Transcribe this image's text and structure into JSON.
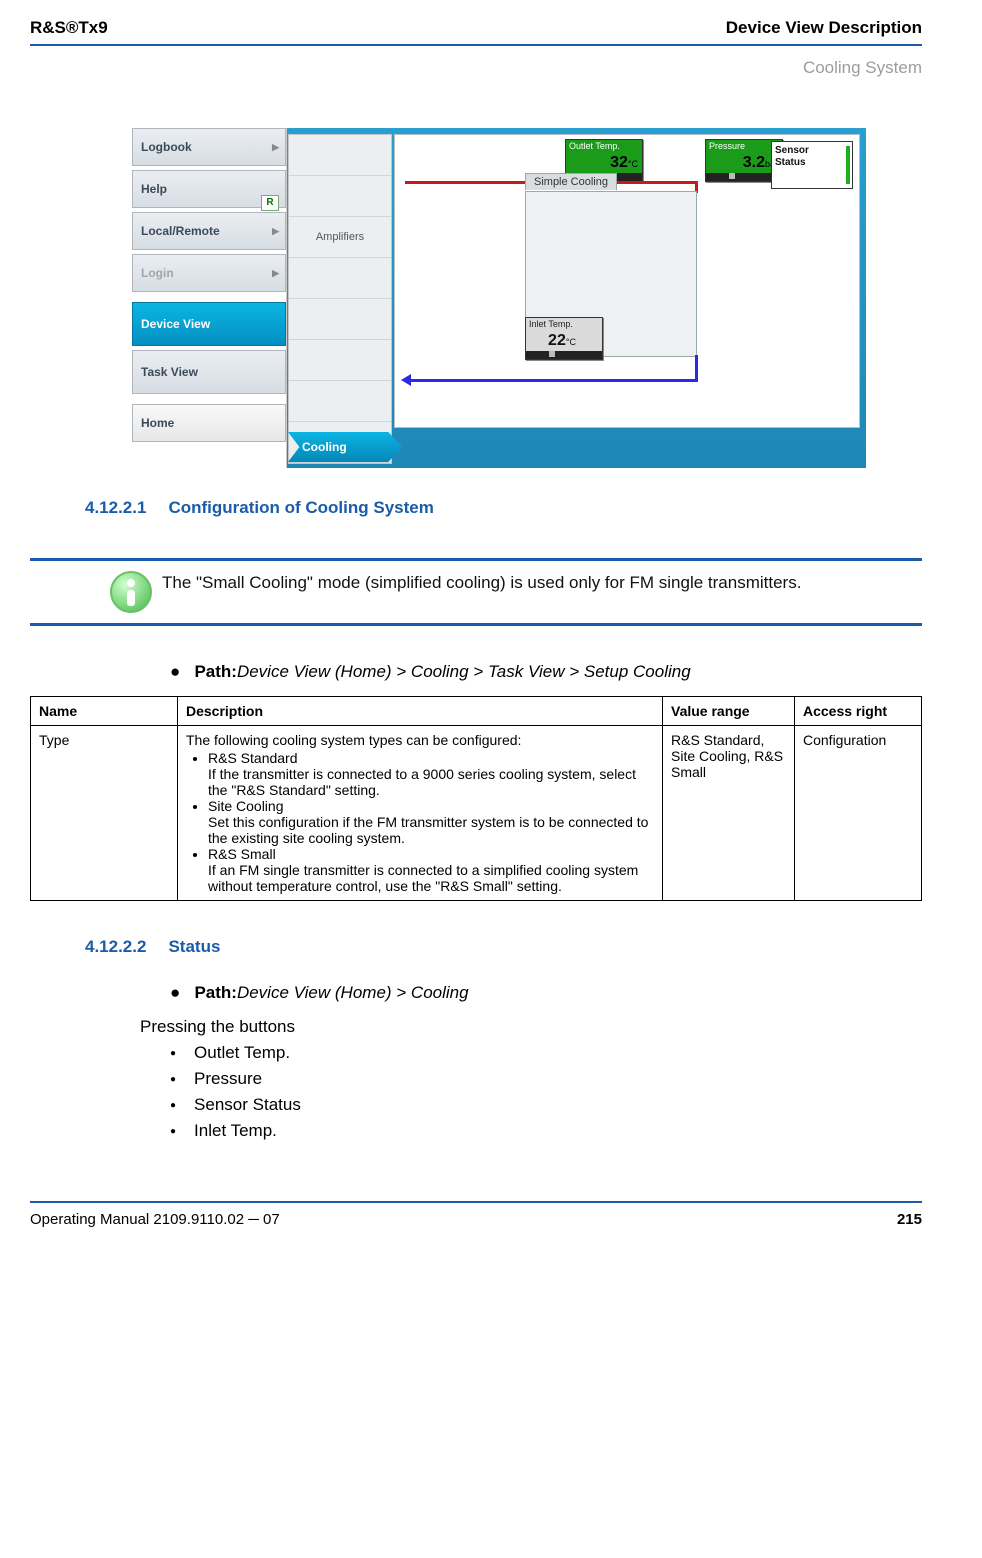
{
  "header": {
    "left": "R&S®Tx9",
    "right": "Device View Description",
    "sub": "Cooling System"
  },
  "screenshot": {
    "nav": {
      "logbook": "Logbook",
      "help": "Help",
      "localremote": "Local/Remote",
      "login": "Login",
      "deviceview": "Device View",
      "taskview": "Task View",
      "home": "Home",
      "r_badge": "R"
    },
    "column": {
      "amplifiers": "Amplifiers"
    },
    "gauges": {
      "outlet_label": "Outlet Temp.",
      "outlet_val": "32",
      "outlet_unit": "°C",
      "pressure_label": "Pressure",
      "pressure_val": "3.2",
      "pressure_unit": "bar",
      "inlet_label": "Inlet Temp.",
      "inlet_val": "22",
      "inlet_unit": "°C"
    },
    "sensor": {
      "l1": "Sensor",
      "l2": "Status"
    },
    "coolbox": "Simple Cooling",
    "crumb": "Cooling"
  },
  "section1": {
    "num": "4.12.2.1",
    "title": "Configuration of Cooling System"
  },
  "info_note": "The \"Small Cooling\" mode (simplified cooling) is used only for FM single transmitters.",
  "path1": {
    "label": "Path:",
    "value": "Device View (Home) > Cooling > Task View > Setup Cooling"
  },
  "table": {
    "headers": {
      "name": "Name",
      "desc": "Description",
      "range": "Value range",
      "access": "Access right"
    },
    "row": {
      "name": "Type",
      "desc_intro": "The following cooling system types can be configured:",
      "b1_t": "R&S Standard",
      "b1_d": "If the transmitter is connected to a 9000 series cooling system, select the \"R&S Standard\" setting.",
      "b2_t": "Site Cooling",
      "b2_d": "Set this configuration if the FM transmitter system is to be connected to the existing site cooling system.",
      "b3_t": "R&S Small",
      "b3_d": "If an FM single transmitter is connected to a simplified cooling system without temperature control, use the \"R&S Small\" setting.",
      "range": "R&S Standard, Site Cooling, R&S Small",
      "access": "Configuration"
    }
  },
  "section2": {
    "num": "4.12.2.2",
    "title": "Status"
  },
  "path2": {
    "label": "Path:",
    "value": "Device View (Home) > Cooling"
  },
  "pressing": "Pressing the buttons",
  "buttons_list": {
    "i1": "Outlet Temp.",
    "i2": "Pressure",
    "i3": "Sensor Status",
    "i4": "Inlet Temp."
  },
  "footer": {
    "left": "Operating Manual 2109.9110.02 ─ 07",
    "right": "215"
  }
}
